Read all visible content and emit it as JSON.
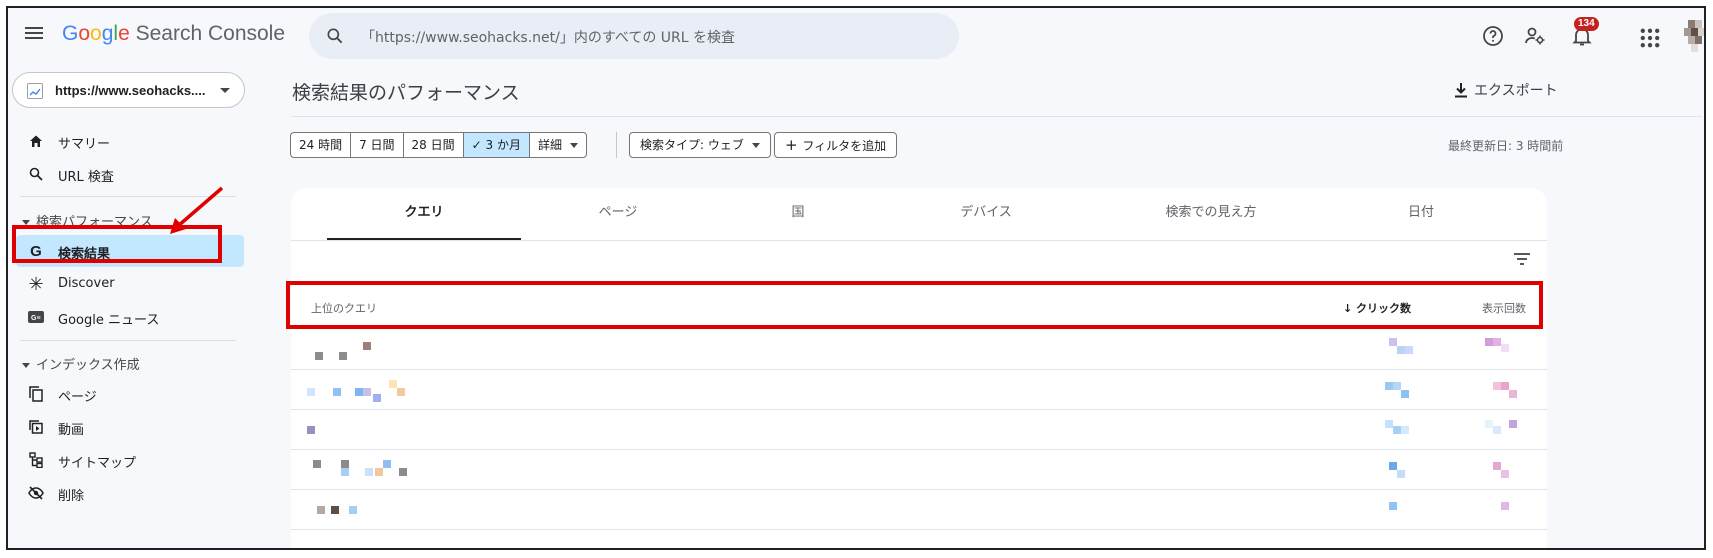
{
  "app": {
    "brand_letters": [
      "G",
      "o",
      "o",
      "g",
      "l",
      "e"
    ],
    "product": " Search Console"
  },
  "search": {
    "placeholder": "「https://www.seohacks.net/」内のすべての URL を検査"
  },
  "topbar": {
    "notification_count": "134",
    "icons": [
      "menu-icon",
      "search-icon",
      "help-icon",
      "admin-icon",
      "notifications-icon",
      "apps-icon"
    ]
  },
  "property": {
    "label": "https://www.seohacks...."
  },
  "sidebar": {
    "top_items": [
      {
        "label": "サマリー",
        "icon": "home-icon"
      },
      {
        "label": "URL 検査",
        "icon": "search-icon"
      }
    ],
    "section_performance": "検索パフォーマンス",
    "performance_items": [
      {
        "label": "検索結果",
        "icon": "google-g-icon",
        "active": true
      },
      {
        "label": "Discover",
        "icon": "asterisk-icon"
      },
      {
        "label": "Google ニュース",
        "icon": "google-news-icon"
      }
    ],
    "section_index": "インデックス作成",
    "index_items": [
      {
        "label": "ページ",
        "icon": "pages-icon"
      },
      {
        "label": "動画",
        "icon": "video-icon"
      },
      {
        "label": "サイトマップ",
        "icon": "sitemap-icon"
      },
      {
        "label": "削除",
        "icon": "removal-icon"
      }
    ]
  },
  "main": {
    "title": "検索結果のパフォーマンス",
    "export_label": "エクスポート",
    "date_ranges": [
      "24 時間",
      "7 日間",
      "28 日間",
      "3 か月",
      "詳細"
    ],
    "selected_range": "3 か月",
    "search_type": "検索タイプ: ウェブ",
    "add_filter": "フィルタを追加",
    "last_updated": "最終更新日: 3 時間前",
    "tabs": [
      "クエリ",
      "ページ",
      "国",
      "デバイス",
      "検索での見え方",
      "日付"
    ],
    "active_tab": "クエリ",
    "table": {
      "col_query": "上位のクエリ",
      "col_clicks": "クリック数",
      "col_impressions": "表示回数",
      "sort_column": "クリック数",
      "sort_direction": "descending"
    }
  },
  "colors": {
    "accent_selected": "#c2e7ff",
    "annotation_red": "#e00000",
    "badge_red": "#c5221f",
    "search_bg": "#e9eef6"
  }
}
